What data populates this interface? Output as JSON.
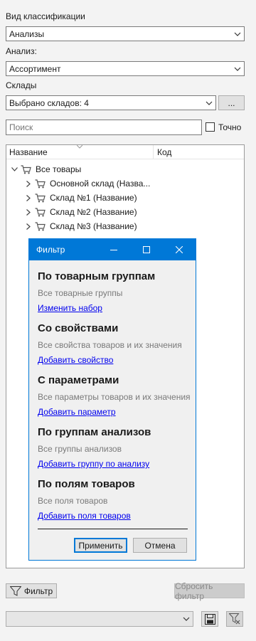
{
  "classification": {
    "label": "Вид классификации",
    "value": "Анализы"
  },
  "analysis": {
    "label": "Анализ:",
    "value": "Ассортимент"
  },
  "warehouses": {
    "label": "Склады",
    "value": "Выбрано складов: 4",
    "more_label": "..."
  },
  "search": {
    "placeholder": "Поиск",
    "exact_label": "Точно"
  },
  "tree": {
    "columns": {
      "name": "Название",
      "code": "Код"
    },
    "root": {
      "label": "Все товары"
    },
    "children": [
      {
        "label": "Основной склад (Назва..."
      },
      {
        "label": "Склад №1 (Название)"
      },
      {
        "label": "Склад №2 (Название)"
      },
      {
        "label": "Склад №3 (Название)"
      }
    ]
  },
  "filter_dialog": {
    "title": "Фильтр",
    "sections": [
      {
        "heading": "По товарным группам",
        "desc": "Все товарные группы",
        "link": "Изменить набор"
      },
      {
        "heading": "Со свойствами",
        "desc": "Все свойства товаров и их значения",
        "link": "Добавить свойство"
      },
      {
        "heading": "С параметрами",
        "desc": "Все параметры товаров и их значения",
        "link": "Добавить параметр"
      },
      {
        "heading": "По группам анализов",
        "desc": "Все группы анализов",
        "link": "Добавить группу по анализу"
      },
      {
        "heading": "По полям товаров",
        "desc": "Все поля товаров",
        "link": "Добавить поля товаров"
      }
    ],
    "apply_label": "Применить",
    "cancel_label": "Отмена"
  },
  "toolbar": {
    "filter_label": "Фильтр",
    "reset_label": "Сбросить фильтр"
  },
  "bottom": {
    "select_value": ""
  },
  "colors": {
    "accent": "#0078d7",
    "link": "#0000ee"
  }
}
